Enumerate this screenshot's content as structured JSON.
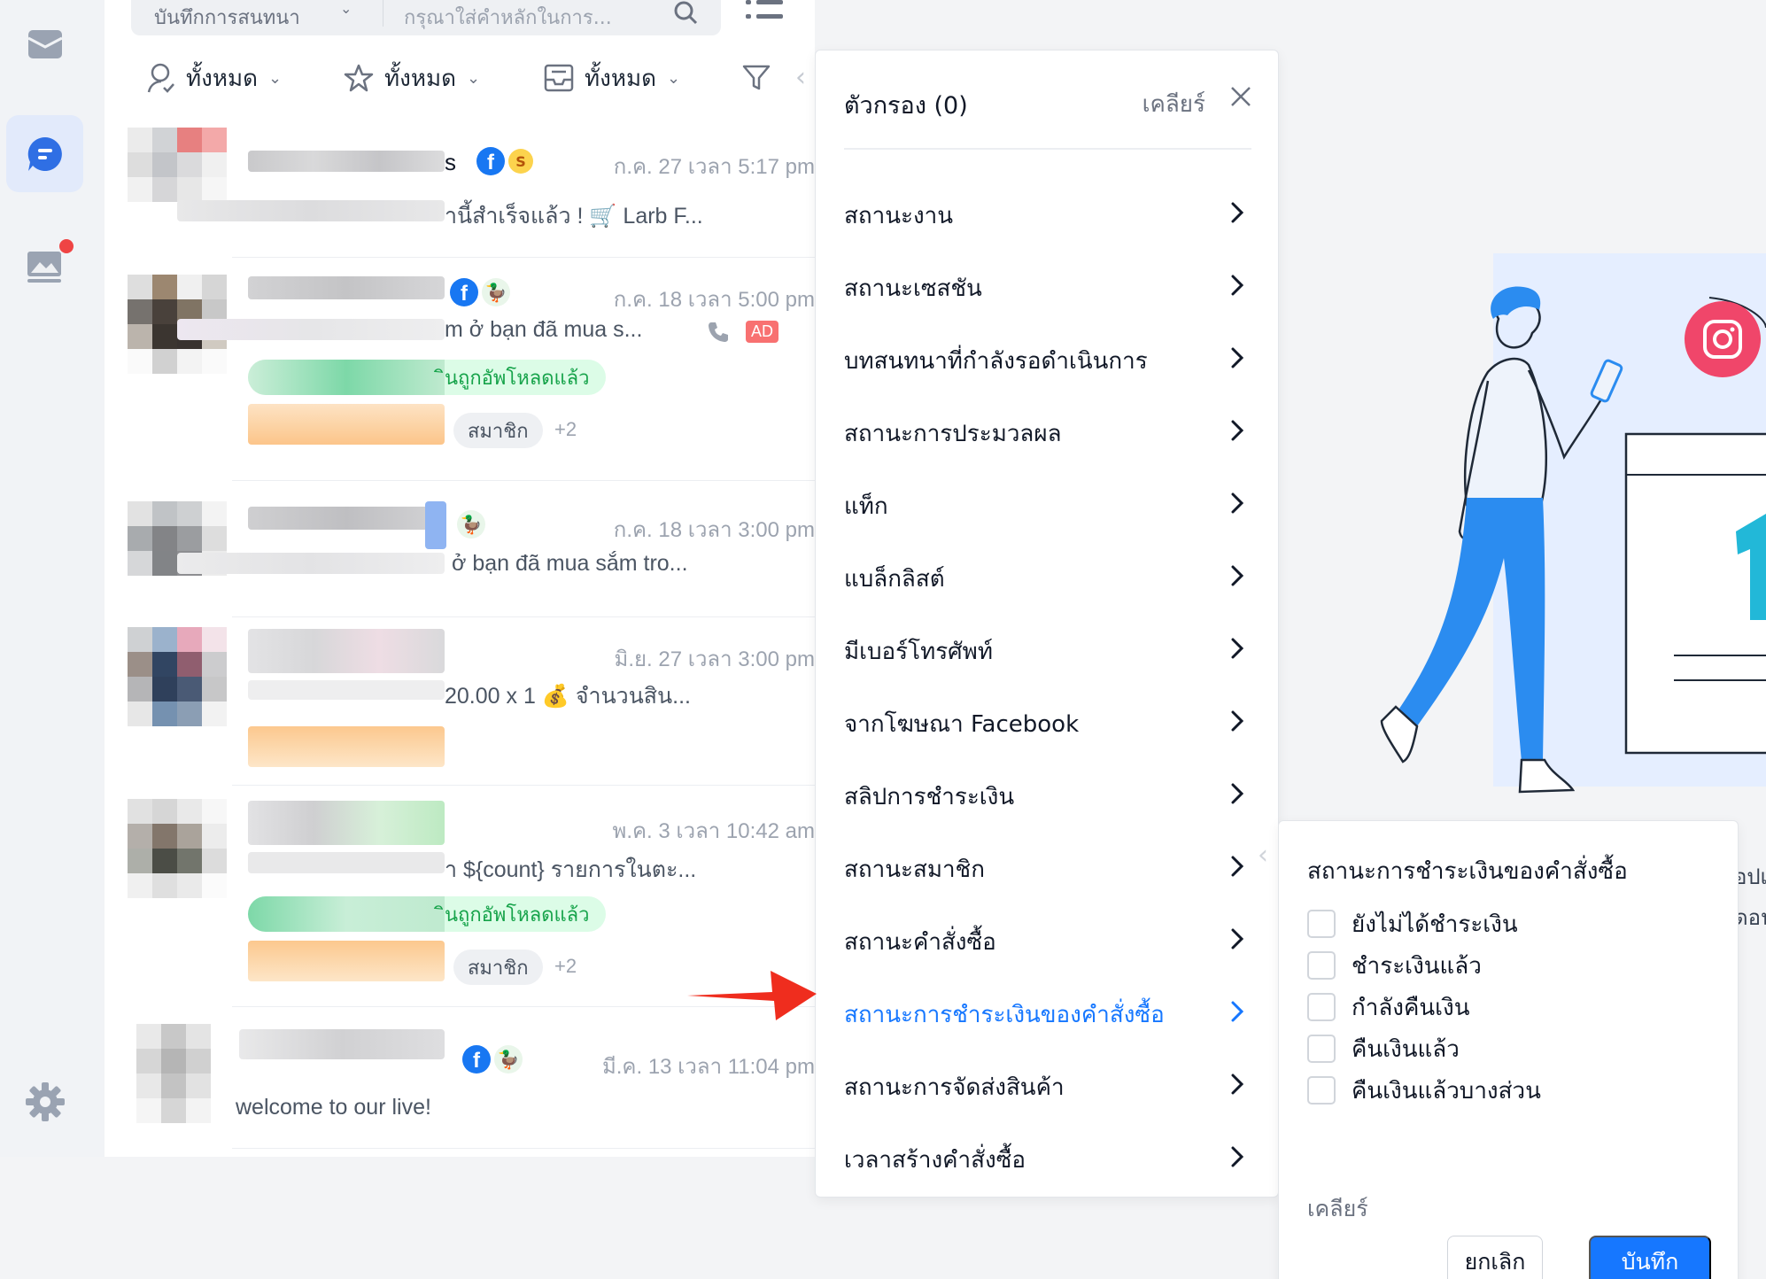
{
  "conversation_list": {
    "type_dropdown": "บันทึกการสนทนา",
    "search_placeholder": "กรุณาใส่คำหลักในการ...",
    "filters": {
      "assignee": "ทั้งหมด",
      "star": "ทั้งหมด",
      "inbox": "ทั้งหมด"
    },
    "rows": [
      {
        "name_tail": "s",
        "time": "ก.ค. 27 เวลา 5:17 pm",
        "message": "านี้สำเร็จแล้ว ! 🛒 Larb F..."
      },
      {
        "time": "ก.ค. 18 เวลา 5:00 pm",
        "message": "m ở bạn đã mua s...",
        "ad": "AD",
        "tag_green": "ินถูกอัพโหลดแล้ว",
        "tag_member": "สมาชิก",
        "more": "+2"
      },
      {
        "time": "ก.ค. 18 เวลา 3:00 pm",
        "message": "ở bạn đã mua sắm tro..."
      },
      {
        "time": "มิ.ย. 27 เวลา 3:00 pm",
        "message": "20.00 x 1 💰 จำนวนสิน..."
      },
      {
        "time": "พ.ค. 3 เวลา 10:42 am",
        "message": "า ${count} รายการในตะ...",
        "tag_green": "ินถูกอัพโหลดแล้ว",
        "tag_member": "สมาชิก",
        "more": "+2"
      },
      {
        "time": "มี.ค. 13 เวลา 11:04 pm",
        "message": "welcome to our live!"
      }
    ]
  },
  "filter_panel": {
    "title": "ตัวกรอง (0)",
    "clear": "เคลียร์",
    "items": [
      "สถานะงาน",
      "สถานะเซสชัน",
      "บทสนทนาที่กำลังรอดำเนินการ",
      "สถานะการประมวลผล",
      "แท็ก",
      "แบล็กลิสต์",
      "มีเบอร์โทรศัพท์",
      "จากโฆษณา Facebook",
      "สลิปการชำระเงิน",
      "สถานะสมาชิก",
      "สถานะคำสั่งซื้อ",
      "สถานะการชำระเงินของคำสั่งซื้อ",
      "สถานะการจัดส่งสินค้า",
      "เวลาสร้างคำสั่งซื้อ"
    ],
    "active_item": "สถานะการชำระเงินของคำสั่งซื้อ"
  },
  "sub_panel": {
    "title": "สถานะการชำระเงินของคำสั่งซื้อ",
    "options": [
      "ยังไม่ได้ชำระเงิน",
      "ชำระเงินแล้ว",
      "กำลังคืนเงิน",
      "คืนเงินแล้ว",
      "คืนเงินแล้วบางส่วน"
    ],
    "clear": "เคลียร์",
    "cancel": "ยกเลิก",
    "save": "บันทึก"
  },
  "background_cut_text": [
    "อปเ",
    "ดอน"
  ],
  "colors": {
    "accent": "#1677ff",
    "arrow": "#ef2d1e",
    "instagram": "#f0466a",
    "illustration_blue": "#2b8cf0"
  },
  "icons": [
    "mail-icon",
    "chat-icon",
    "broadcast-icon",
    "settings-icon",
    "user-icon",
    "star-icon",
    "inbox-icon",
    "filter-icon",
    "search-icon",
    "list-icon",
    "facebook-icon",
    "chevron-right-icon",
    "close-icon",
    "instagram-icon"
  ]
}
